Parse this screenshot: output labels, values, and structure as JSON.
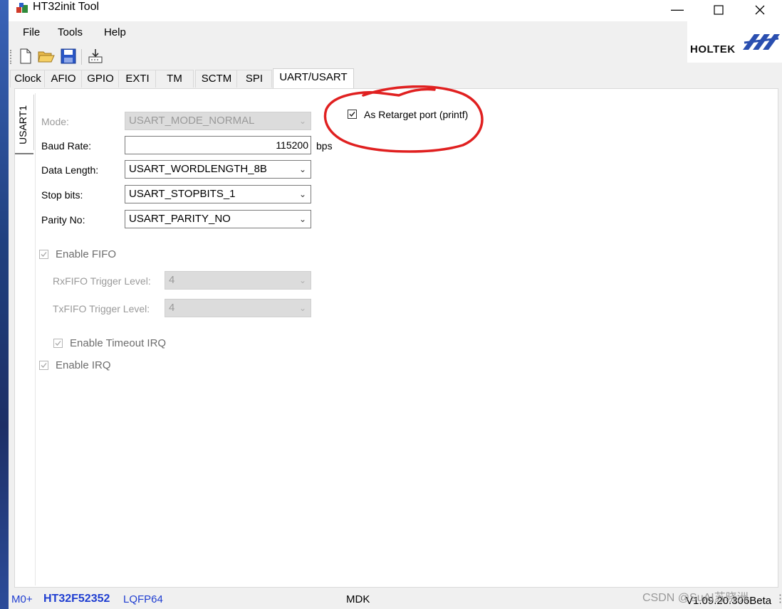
{
  "window": {
    "title": "HT32init Tool"
  },
  "menu": [
    "File",
    "Tools",
    "Help"
  ],
  "logo": {
    "text": "HOLTEK"
  },
  "toolbar": {
    "buttons": [
      "new-file-icon",
      "open-folder-icon",
      "save-icon",
      "download-icon"
    ]
  },
  "tabs": [
    "Clock",
    "AFIO",
    "GPIO",
    "EXTI",
    "TM",
    "SCTM",
    "SPI",
    "UART/USART"
  ],
  "active_tab": "UART/USART",
  "side_tab": "USART1",
  "form": {
    "mode_label": "Mode:",
    "mode_value": "USART_MODE_NORMAL",
    "baud_label": "Baud Rate:",
    "baud_value": "115200",
    "baud_unit": "bps",
    "datalen_label": "Data Length:",
    "datalen_value": "USART_WORDLENGTH_8B",
    "stop_label": "Stop bits:",
    "stop_value": "USART_STOPBITS_1",
    "parity_label": "Parity No:",
    "parity_value": "USART_PARITY_NO",
    "enable_fifo": "Enable FIFO",
    "rx_fifo_label": "RxFIFO Trigger Level:",
    "rx_fifo_value": "4",
    "tx_fifo_label": "TxFIFO Trigger Level:",
    "tx_fifo_value": "4",
    "enable_timeout": "Enable Timeout IRQ",
    "enable_irq": "Enable IRQ",
    "retarget": "As Retarget port (printf)"
  },
  "status": {
    "core": "M0+",
    "chip": "HT32F52352",
    "package": "LQFP64",
    "ide": "MDK",
    "version": "V1.09.20.306Beta"
  },
  "watermark": "CSDN @SuAI苏晓洲",
  "colors": {
    "annotation": "#e02020",
    "status_blue": "#1f3ed1",
    "window_bg": "#f0f0f0"
  }
}
